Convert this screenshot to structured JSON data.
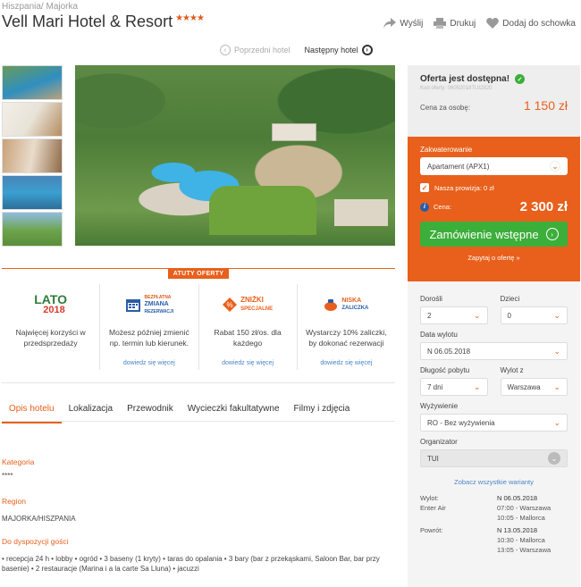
{
  "breadcrumb": {
    "country": "Hiszpania",
    "sep": "/",
    "region": "Majorka"
  },
  "hotel": {
    "name": "Vell Mari Hotel & Resort",
    "stars": "★★★★"
  },
  "actions": {
    "share": "Wyślij",
    "print": "Drukuj",
    "favorite": "Dodaj do schowka"
  },
  "hotel_nav": {
    "prev": "Poprzedni hotel",
    "next": "Następny hotel"
  },
  "benefits": {
    "badge": "ATUTY OFERTY",
    "items": [
      {
        "logo_top": "LATO",
        "logo_bottom": "2018",
        "desc": "Najwięcej korzyści w przedsprzedaży",
        "more": ""
      },
      {
        "logo_top": "BEZPŁATNA",
        "logo_mid": "ZMIANA",
        "logo_bottom": "REZERWACJI",
        "desc": "Możesz później zmienić np. termin lub kierunek.",
        "more": "dowiedz się więcej"
      },
      {
        "logo_top": "ZNIŻKI",
        "logo_bottom": "SPECJALNE",
        "desc": "Rabat 150 zł/os. dla każdego",
        "more": "dowiedz się więcej"
      },
      {
        "logo_top": "NISKA",
        "logo_bottom": "ZALICZKA",
        "desc": "Wystarczy 10% zaliczki, by dokonać rezerwacji",
        "more": "dowiedz się więcej"
      }
    ]
  },
  "tabs": [
    "Opis hotelu",
    "Lokalizacja",
    "Przewodnik",
    "Wycieczki fakultatywne",
    "Filmy i zdjęcia"
  ],
  "details": {
    "kategoria_label": "Kategoria",
    "kategoria_val": "****",
    "region_label": "Region",
    "region_val": "MAJORKA/HISZPANIA",
    "dyspozycja_label": "Do dyspozycji gości",
    "dyspozycja_val": "• recepcja 24 h • lobby • ogród • 3 baseny (1 kryty) • taras do opalania • 3 bary (bar z przekąskami, Saloon Bar, bar przy basenie) • 2 restauracje (Marina i a la carte Sa Lluna) • jacuzzi"
  },
  "offer": {
    "available": "Oferta jest dostępna!",
    "code": "Kod oferty: 06052018TUI2820",
    "price_per_person_label": "Cena za osobę:",
    "price_per_person": "1 150 zł",
    "accommodation_label": "Zakwaterowanie",
    "accommodation_value": "Apartament (APX1)",
    "commission_label": "Nasza prowizja: 0 zł",
    "price_label": "Cena:",
    "price_total": "2 300 zł",
    "order_button": "Zamówienie wstępne",
    "ask": "Zapytaj o ofertę »"
  },
  "form": {
    "adults_label": "Dorośli",
    "adults_value": "2",
    "children_label": "Dzieci",
    "children_value": "0",
    "departure_date_label": "Data wylotu",
    "departure_date_value": "N 06.05.2018",
    "length_label": "Długość pobytu",
    "length_value": "7 dni",
    "from_label": "Wylot z",
    "from_value": "Warszawa",
    "board_label": "Wyżywienie",
    "board_value": "RO - Bez wyżywienia",
    "organizer_label": "Organizator",
    "organizer_value": "TUI",
    "all_variants": "Zobacz wszystkie warianty"
  },
  "trip": {
    "out_label": "Wylot:",
    "out_date": "N 06.05.2018",
    "airline": "Enter Air",
    "out_line1": "07:00 - Warszawa",
    "out_line2": "10:05 - Mallorca",
    "back_label": "Powrót:",
    "back_date": "N 13.05.2018",
    "back_line1": "10:30 - Mallorca",
    "back_line2": "13:05 - Warszawa"
  },
  "colors": {
    "accent": "#e8601c",
    "cta": "#3cae3a",
    "link": "#4a86c8"
  }
}
